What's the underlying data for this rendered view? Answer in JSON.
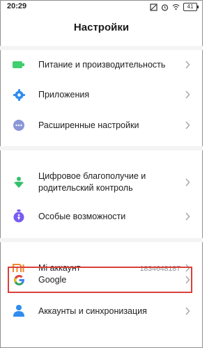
{
  "status": {
    "time": "20:29",
    "battery": "41"
  },
  "title": "Настройки",
  "items": [
    {
      "id": "power",
      "label": "Питание и производительность",
      "icon": "battery-icon",
      "color": "#3ecf6e"
    },
    {
      "id": "apps",
      "label": "Приложения",
      "icon": "gear-icon",
      "color": "#2f8cf0"
    },
    {
      "id": "advanced",
      "label": "Расширенные настройки",
      "icon": "more-dots-icon",
      "color": "#8a96d8"
    },
    {
      "id": "wellbeing",
      "label_line1": "Цифровое благополучие и",
      "label_line2": "родительский контроль",
      "icon": "wellbeing-icon",
      "color": "#35c06c"
    },
    {
      "id": "accessibility",
      "label": "Особые возможности",
      "icon": "accessibility-icon",
      "color": "#7a5cf0"
    },
    {
      "id": "mi",
      "label": "Mi аккаунт",
      "value": "1834648187",
      "icon": "mi-logo-icon",
      "color": "#f0862e"
    },
    {
      "id": "google",
      "label": "Google",
      "icon": "google-icon"
    },
    {
      "id": "accounts",
      "label": "Аккаунты и синхронизация",
      "icon": "user-icon",
      "color": "#2f8cf0"
    }
  ],
  "highlight_color": "#d9403a"
}
